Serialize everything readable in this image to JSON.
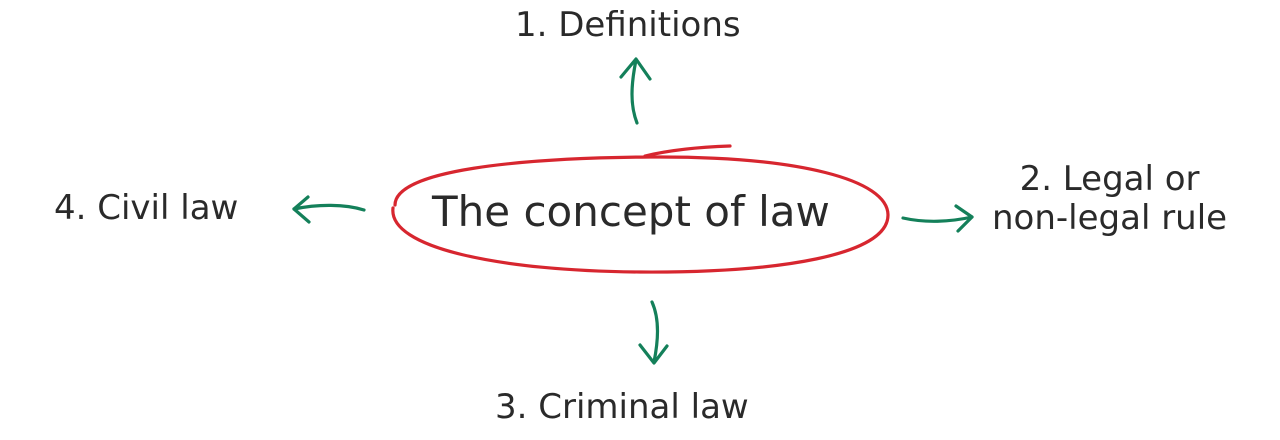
{
  "center": {
    "text": "The concept of law"
  },
  "branches": {
    "definitions": "1. Definitions",
    "legal_line1": "2. Legal or",
    "legal_line2": "non-legal rule",
    "criminal": "3. Criminal law",
    "civil": "4. Civil law"
  },
  "colors": {
    "ellipse": "#d7262f",
    "arrow": "#14805a",
    "text": "#2a2a2a"
  }
}
